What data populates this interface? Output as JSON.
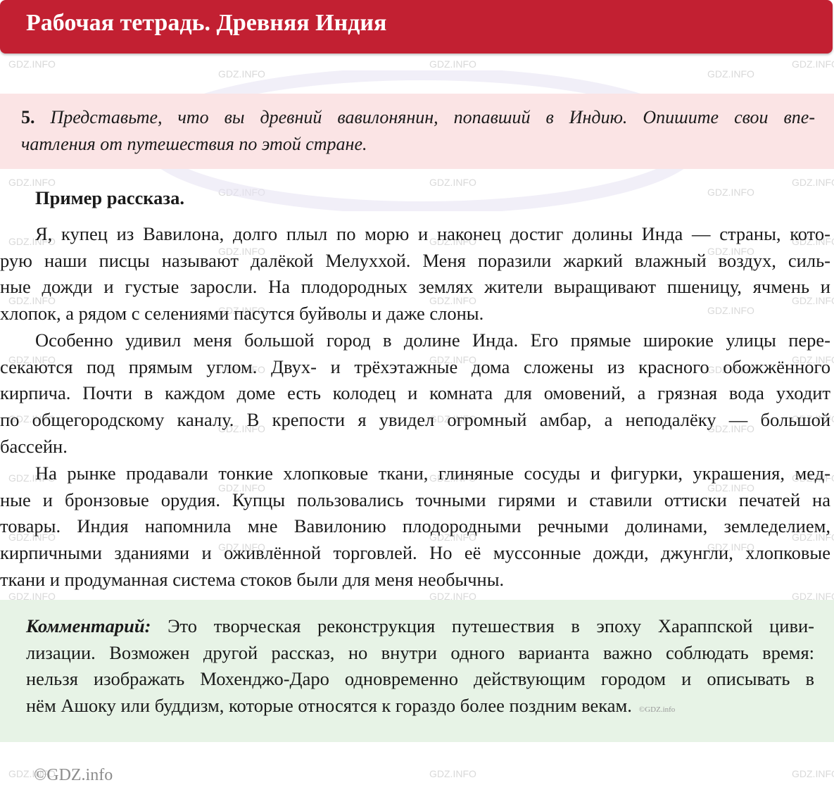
{
  "header": {
    "title": "Рабочая тетрадь. Древняя Индия"
  },
  "task": {
    "number": "5.",
    "lines": [
      "Представьте, что вы древний вавилонянин, попавший в Индию. Опишите свои впе-",
      "чатления от путешествия по этой стране."
    ]
  },
  "example": {
    "title": "Пример рассказа.",
    "paragraphs": [
      [
        "Я, купец из Вавилона, долго плыл по морю и наконец достиг долины Инда — страны, кото-",
        "рую наши писцы называют далёкой Мелуххой. Меня поразили жаркий влажный воздух, силь-",
        "ные дожди и густые заросли. На плодородных землях жители выращивают пшеницу, ячмень и",
        "хлопок, а рядом с селениями пасутся буйволы и даже слоны."
      ],
      [
        "Особенно удивил меня большой город в долине Инда. Его прямые широкие улицы пере-",
        "секаются под прямым углом. Двух- и трёхэтажные дома сложены из красного обожжённого",
        "кирпича. Почти в каждом доме есть колодец и комната для омовений, а грязная вода уходит",
        "по общегородскому каналу. В крепости я увидел огромный амбар, а неподалёку — большой",
        "бассейн."
      ],
      [
        "На рынке продавали тонкие хлопковые ткани, глиняные сосуды и фигурки, украшения, мед-",
        "ные и бронзовые орудия. Купцы пользовались точными гирями и ставили оттиски печатей на",
        "товары. Индия напомнила мне Вавилонию плодородными речными долинами, земледелием,",
        "кирпичными зданиями и оживлённой торговлей. Но её муссонные дожди, джунгли, хлопковые",
        "ткани и продуманная система стоков были для меня необычны."
      ]
    ]
  },
  "comment": {
    "label": "Комментарий:",
    "lines": [
      "Это творческая реконструкция путешествия в эпоху Хараппской циви-",
      "лизации. Возможен другой рассказ, но внутри одного варианта важно соблюдать время:",
      "нельзя изображать Мохенджо-Даро одновременно действующим городом и описывать в",
      "нём Ашоку или буддизм, которые относятся к гораздо более поздним векам."
    ],
    "watermark": "©GDZ.info"
  },
  "watermark": {
    "text": "GDZ.INFO",
    "big_text": "GDZ.INFO"
  },
  "footer": {
    "text": "©GDZ.info"
  },
  "colors": {
    "header_bg": "#c22032",
    "task_bg": "#fbe4e5",
    "comment_bg": "#e7f3e6"
  }
}
